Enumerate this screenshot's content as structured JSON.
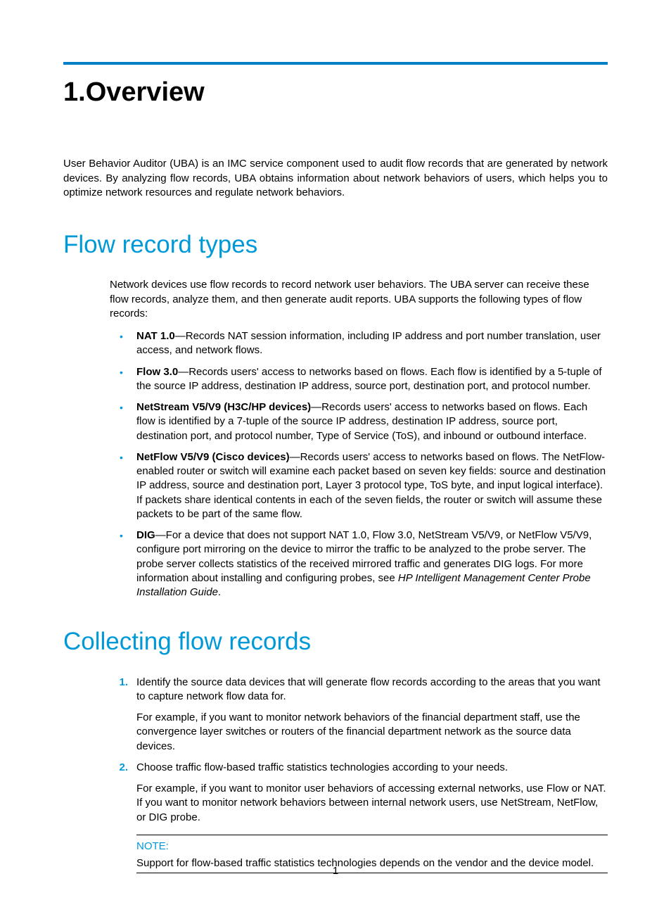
{
  "chapter": {
    "title": "1.Overview"
  },
  "intro": "User Behavior Auditor (UBA) is an IMC service component used to audit flow records that are generated by network devices. By analyzing flow records, UBA obtains information about network behaviors of users, which helps you to optimize network resources and regulate network behaviors.",
  "section1": {
    "title": "Flow record types",
    "lead": "Network devices use flow records to record network user behaviors. The UBA server can receive these flow records, analyze them, and then generate audit reports. UBA supports the following types of flow records:",
    "items": [
      {
        "term": "NAT 1.0",
        "desc": "—Records NAT session information, including IP address and port number translation, user access, and network flows."
      },
      {
        "term": "Flow 3.0",
        "desc": "—Records users' access to networks based on flows. Each flow is identified by a 5-tuple of the source IP address, destination IP address, source port, destination port, and protocol number."
      },
      {
        "term": "NetStream V5/V9 (H3C/HP devices)",
        "desc": "—Records users' access to networks based on flows. Each flow is identified by a 7-tuple of the source IP address, destination IP address, source port, destination port, and protocol number, Type of Service (ToS), and inbound or outbound interface."
      },
      {
        "term": "NetFlow V5/V9 (Cisco devices)",
        "desc": "—Records users' access to networks based on flows. The NetFlow-enabled router or switch will examine each packet based on seven key fields: source and destination IP address, source and destination port, Layer 3 protocol type, ToS byte, and input logical interface). If packets share identical contents in each of the seven fields, the router or switch will assume these packets to be part of the same flow."
      },
      {
        "term": "DIG",
        "desc_pre": "—For a device that does not support NAT 1.0, Flow 3.0, NetStream V5/V9, or NetFlow V5/V9, configure port mirroring on the device to mirror the traffic to be analyzed to the probe server. The probe server collects statistics of the received mirrored traffic and generates DIG logs. For more information about installing and configuring probes, see ",
        "desc_ital": "HP Intelligent Management Center Probe Installation Guide",
        "desc_post": "."
      }
    ]
  },
  "section2": {
    "title": "Collecting flow records",
    "steps": [
      {
        "num": "1.",
        "p1": "Identify the source data devices that will generate flow records according to the areas that you want to capture network flow data for.",
        "p2": "For example, if you want to monitor network behaviors of the financial department staff, use the convergence layer switches or routers of the financial department network as the source data devices."
      },
      {
        "num": "2.",
        "p1": "Choose traffic flow-based traffic statistics technologies according to your needs.",
        "p2": "For example, if you want to monitor user behaviors of accessing external networks, use Flow or NAT. If you want to monitor network behaviors between internal network users, use NetStream, NetFlow, or DIG probe."
      }
    ],
    "note": {
      "label": "NOTE:",
      "text": "Support for flow-based traffic statistics technologies depends on the vendor and the device model."
    }
  },
  "pagenum": "1"
}
